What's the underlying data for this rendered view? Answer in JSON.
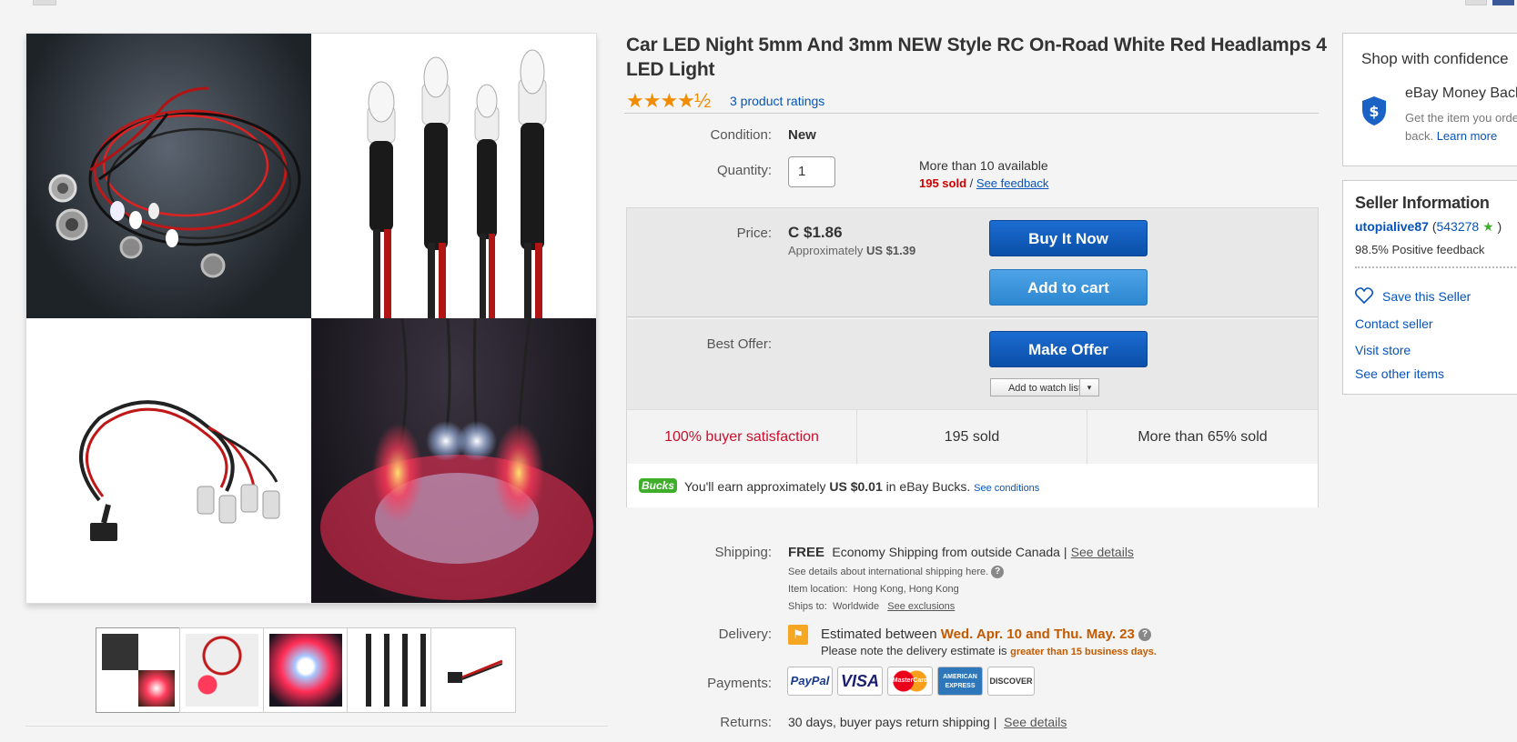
{
  "product": {
    "title": "Car LED Night 5mm And 3mm NEW Style RC On-Road White Red Headlamps 4 LED Light",
    "stars": "★★★★½",
    "ratings_label": "3 product ratings",
    "rating_value": 4.5
  },
  "condition": {
    "label": "Condition:",
    "value": "New"
  },
  "quantity": {
    "label": "Quantity:",
    "value": "1",
    "available": "More than 10 available",
    "sold": "195 sold",
    "sep": "/",
    "feedback_link": "See feedback"
  },
  "price": {
    "label": "Price:",
    "value": "C $1.86",
    "approx_prefix": "Approximately",
    "approx_value": "US $1.39"
  },
  "buttons": {
    "buy_now": "Buy It Now",
    "add_to_cart": "Add to cart",
    "make_offer": "Make Offer",
    "watch_list": "Add to watch list",
    "watch_dropdown": "▾"
  },
  "best_offer": {
    "label": "Best Offer:"
  },
  "stats": [
    "100% buyer satisfaction",
    "195 sold",
    "More than 65% sold"
  ],
  "bucks": {
    "badge": "Bucks",
    "prefix": "You'll earn approximately",
    "amount": "US $0.01",
    "suffix": "in eBay Bucks.",
    "link": "See conditions"
  },
  "shipping": {
    "label": "Shipping:",
    "free": "FREE",
    "method": "Economy Shipping from outside Canada |",
    "details_link": "See details",
    "intl_note": "See details about international shipping here.",
    "location_label": "Item location:",
    "location": "Hong Kong, Hong Kong",
    "ships_label": "Ships to:",
    "ships": "Worldwide",
    "exclusions_link": "See exclusions"
  },
  "delivery": {
    "label": "Delivery:",
    "prefix": "Estimated between",
    "dates": "Wed. Apr. 10 and Thu. May. 23",
    "note": "Please note the delivery estimate is",
    "note_highlight": "greater than 15 business days."
  },
  "payments": {
    "label": "Payments:",
    "methods": [
      "PayPal",
      "VISA",
      "MasterCard",
      "AMERICAN EXPRESS",
      "DISCOVER"
    ]
  },
  "returns": {
    "label": "Returns:",
    "text": "30 days, buyer pays return shipping |",
    "link": "See details"
  },
  "confidence": {
    "title": "Shop with confidence",
    "mb_title": "eBay Money Back G",
    "mb_text_1": "Get the item you orde",
    "mb_text_2": "back.",
    "learn_more": "Learn more"
  },
  "seller": {
    "title": "Seller Information",
    "name": "utopialive87",
    "score_open": "(",
    "score": "543278",
    "score_close": ")",
    "positive": "98.5% Positive feedback",
    "save": "Save this Seller",
    "contact": "Contact seller",
    "store": "Visit store",
    "other": "See other items"
  },
  "colors": {
    "link": "#0654ba",
    "buy_button": "#0a4fa8",
    "cart_button": "#2c87d1",
    "star": "#f18c00",
    "sold_red": "#c00000",
    "satisfaction_red": "#c8102e",
    "bucks_green": "#3fae2a"
  }
}
